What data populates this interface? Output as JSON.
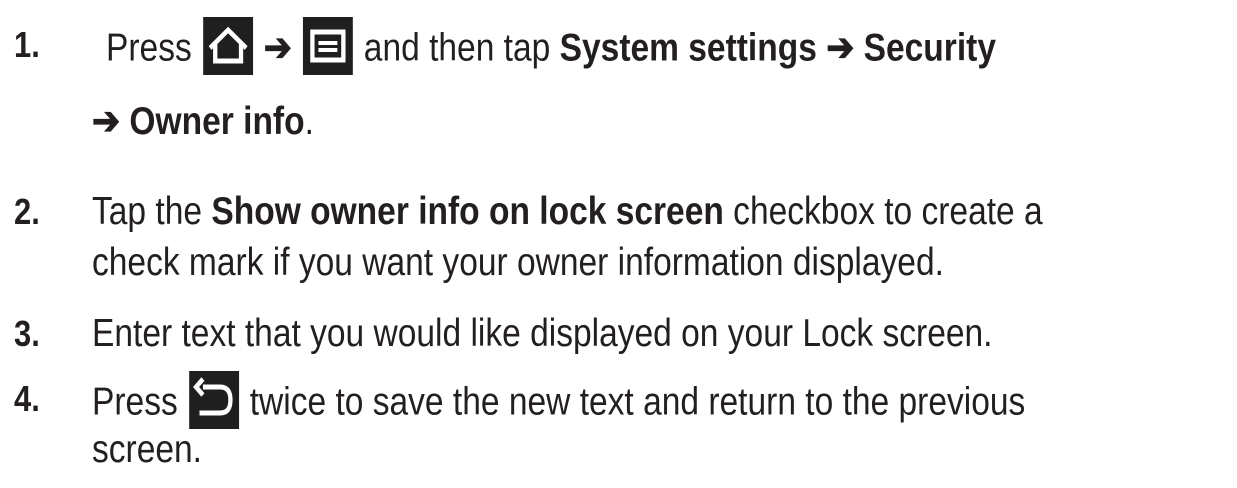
{
  "steps": [
    {
      "number": "1.",
      "lines": [
        {
          "pre": "Press",
          "arrow1": "➔",
          "mid": "and then tap",
          "bold1": "System settings",
          "arrow2": "➔",
          "bold2": "Security"
        },
        {
          "arrow": "➔",
          "bold": "Owner info",
          "post": "."
        }
      ]
    },
    {
      "number": "2.",
      "lines": [
        {
          "pre": "Tap the",
          "bold": "Show owner info on lock screen",
          "post": "checkbox to create a"
        },
        {
          "text": "check mark if you want your owner information displayed."
        }
      ]
    },
    {
      "number": "3.",
      "lines": [
        {
          "text": "Enter text that you would like displayed on your Lock screen."
        }
      ]
    },
    {
      "number": "4.",
      "lines": [
        {
          "pre": "Press",
          "post": "twice to save the new text and return to the previous"
        },
        {
          "text": "screen."
        }
      ]
    }
  ],
  "icons": {
    "home": "home-icon",
    "menu": "menu-icon",
    "back": "back-icon"
  },
  "colors": {
    "text": "#231f20",
    "icon_bg": "#1f1f1f",
    "icon_fg": "#ffffff"
  }
}
